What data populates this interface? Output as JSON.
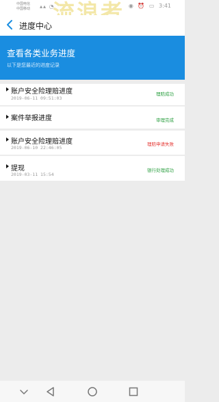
{
  "status_bar": {
    "carrier_1": "中国电信",
    "carrier_2": "中国移动",
    "watermark": "流浪者",
    "time": "3:41"
  },
  "header": {
    "title": "进度中心"
  },
  "banner": {
    "title": "查看各类业务进度",
    "subtitle": "以下是您最近的进度记录"
  },
  "records": [
    {
      "title": "账户安全险理赔进度",
      "time": "2019-06-11 09:51:03",
      "status": "理赔成功",
      "status_color": "#2ea043"
    },
    {
      "title": "案件举报进度",
      "time": "",
      "status": "审理完成",
      "status_color": "#2ea043"
    },
    {
      "title": "账户安全险理赔进度",
      "time": "2019-06-10 22:46:05",
      "status": "理赔申请失败",
      "status_color": "#e53935"
    },
    {
      "title": "提现",
      "time": "2019-03-11 15:54",
      "status": "银行处理成功",
      "status_color": "#2ea043"
    }
  ],
  "colors": {
    "accent": "#1a8de0",
    "success": "#2ea043",
    "failure": "#e53935"
  }
}
